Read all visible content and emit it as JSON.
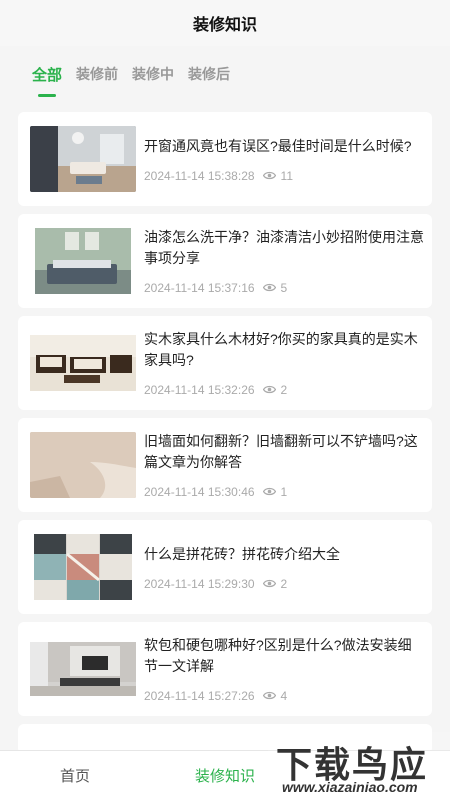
{
  "header": {
    "title": "装修知识"
  },
  "tabs": [
    {
      "label": "全部",
      "active": true
    },
    {
      "label": "装修前",
      "active": false
    },
    {
      "label": "装修中",
      "active": false
    },
    {
      "label": "装修后",
      "active": false
    }
  ],
  "articles": [
    {
      "title": "开窗通风竟也有误区?最佳时间是什么时候?",
      "date": "2024-11-14 15:38:28",
      "views": "11"
    },
    {
      "title": "油漆怎么洗干净？油漆清洁小妙招附使用注意事项分享",
      "date": "2024-11-14 15:37:16",
      "views": "5"
    },
    {
      "title": "实木家具什么木材好?你买的家具真的是实木家具吗?",
      "date": "2024-11-14 15:32:26",
      "views": "2"
    },
    {
      "title": "旧墙面如何翻新？旧墙翻新可以不铲墙吗?这篇文章为你解答",
      "date": "2024-11-14 15:30:46",
      "views": "1"
    },
    {
      "title": "什么是拼花砖？拼花砖介绍大全",
      "date": "2024-11-14 15:29:30",
      "views": "2"
    },
    {
      "title": "软包和硬包哪种好?区别是什么?做法安装细节一文详解",
      "date": "2024-11-14 15:27:26",
      "views": "4"
    }
  ],
  "bottom_nav": [
    {
      "label": "首页",
      "active": false
    },
    {
      "label": "装修知识",
      "active": true
    }
  ],
  "watermark": {
    "title": "下载鸟应用",
    "url": "www.xiazainiao.com"
  },
  "colors": {
    "accent": "#2bb24c"
  }
}
